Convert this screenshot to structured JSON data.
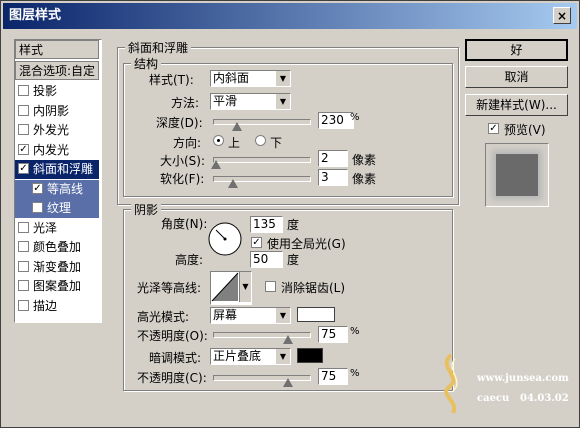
{
  "window": {
    "title": "图层样式",
    "close": "×"
  },
  "left_panel": {
    "header": "样式",
    "blend": "混合选项:自定",
    "items": [
      {
        "label": "投影",
        "checked": false
      },
      {
        "label": "内阴影",
        "checked": false
      },
      {
        "label": "外发光",
        "checked": false
      },
      {
        "label": "内发光",
        "checked": true
      },
      {
        "label": "斜面和浮雕",
        "checked": true
      },
      {
        "label": "等高线",
        "checked": true
      },
      {
        "label": "纹理",
        "checked": false
      },
      {
        "label": "光泽",
        "checked": false
      },
      {
        "label": "颜色叠加",
        "checked": false
      },
      {
        "label": "渐变叠加",
        "checked": false
      },
      {
        "label": "图案叠加",
        "checked": false
      },
      {
        "label": "描边",
        "checked": false
      }
    ],
    "check_mark": "✓"
  },
  "bevel": {
    "group_title": "斜面和浮雕",
    "structure_title": "结构",
    "style_label": "样式(T):",
    "style_value": "内斜面",
    "technique_label": "方法:",
    "technique_value": "平滑",
    "depth_label": "深度(D):",
    "depth_value": "230",
    "depth_unit": "%",
    "depth_level": 0.23,
    "direction_label": "方向:",
    "dir_up": "上",
    "dir_down": "下",
    "size_label": "大小(S):",
    "size_value": "2",
    "size_unit": "像素",
    "size_level": 0.02,
    "soften_label": "软化(F):",
    "soften_value": "3",
    "soften_unit": "像素",
    "soften_level": 0.19
  },
  "shading": {
    "group_title": "阴影",
    "angle_label": "角度(N):",
    "angle_value": "135",
    "angle_unit": "度",
    "global_light_label": "使用全局光(G)",
    "altitude_label": "高度:",
    "altitude_value": "50",
    "altitude_unit": "度",
    "gloss_label": "光泽等高线:",
    "antialias_label": "消除锯齿(L)",
    "highlight_mode_label": "高光模式:",
    "highlight_mode_value": "屏幕",
    "highlight_color": "#ffffff",
    "hl_opacity_label": "不透明度(O):",
    "hl_opacity_value": "75",
    "hl_opacity_unit": "%",
    "hl_opacity_level": 0.75,
    "shadow_mode_label": "暗调模式:",
    "shadow_mode_value": "正片叠底",
    "shadow_color": "#000000",
    "sh_opacity_label": "不透明度(C):",
    "sh_opacity_value": "75",
    "sh_opacity_unit": "%",
    "sh_opacity_level": 0.75
  },
  "buttons": {
    "ok": "好",
    "cancel": "取消",
    "new_style": "新建样式(W)...",
    "preview_label": "预览(V)"
  },
  "watermark": {
    "site": "www.junsea.com",
    "author": "caecu",
    "date": "04.03.02"
  },
  "colors": {
    "titlebar": "#0a246a",
    "dialog": "#d4d0c8",
    "selection": "#0a246a"
  },
  "icons": [
    "close-icon",
    "checkbox-icon",
    "radio-icon",
    "dropdown-arrow-icon",
    "slider-thumb-icon",
    "angle-dial-icon",
    "contour-curve-icon",
    "preview-swatch-icon",
    "watermark-logo-icon"
  ]
}
